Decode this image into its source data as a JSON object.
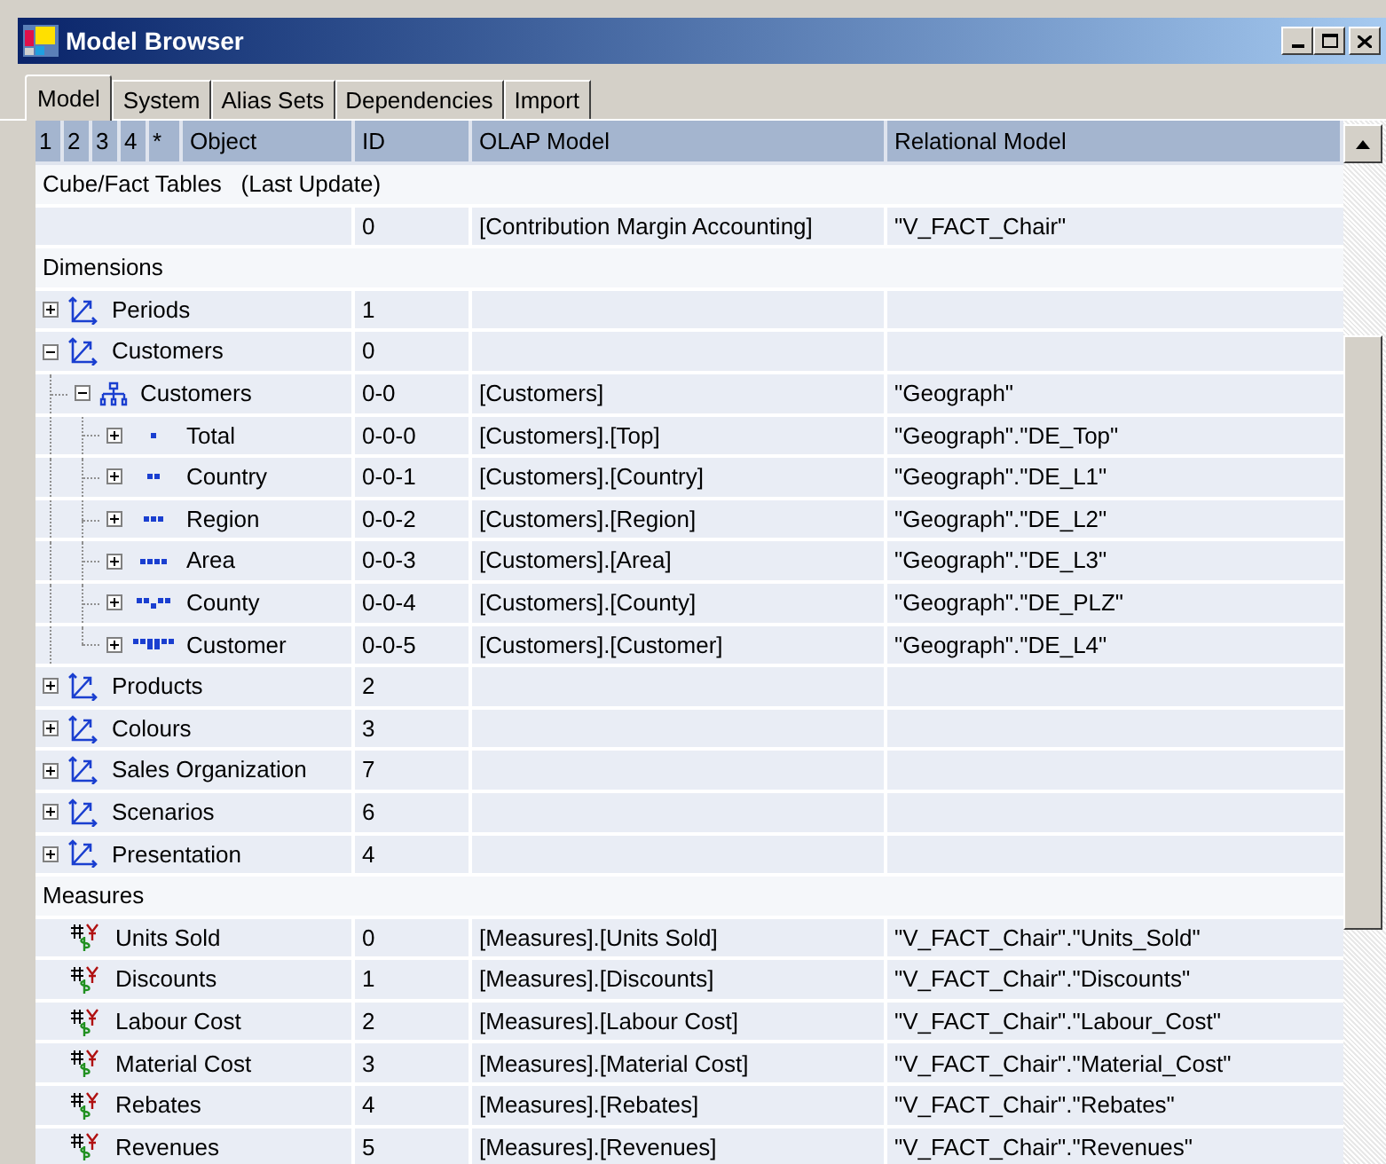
{
  "window": {
    "title": "Model Browser"
  },
  "tabs": [
    {
      "label": "Model",
      "selected": true
    },
    {
      "label": "System",
      "selected": false
    },
    {
      "label": "Alias Sets",
      "selected": false
    },
    {
      "label": "Dependencies",
      "selected": false
    },
    {
      "label": "Import",
      "selected": false
    }
  ],
  "table": {
    "level_buttons": [
      "1",
      "2",
      "3",
      "4",
      "*"
    ],
    "columns": [
      "Object",
      "ID",
      "OLAP Model",
      "Relational Model"
    ],
    "sections": [
      {
        "title": "Cube/Fact Tables   (Last Update)",
        "rows": [
          {
            "kind": "fact",
            "id": "0",
            "olap": "[Contribution Margin Accounting]",
            "relational": "\"V_FACT_Chair\""
          }
        ]
      },
      {
        "title": "Dimensions",
        "rows": [
          {
            "kind": "dimension",
            "object": "Periods",
            "id": "1",
            "expanded": false
          },
          {
            "kind": "dimension",
            "object": "Customers",
            "id": "0",
            "expanded": true,
            "children": [
              {
                "kind": "hierarchy",
                "object": "Customers",
                "id": "0-0",
                "olap": "[Customers]",
                "relational": "\"Geograph\"",
                "expanded": true,
                "children": [
                  {
                    "kind": "level",
                    "object": "Total",
                    "id": "0-0-0",
                    "olap": "[Customers].[Top]",
                    "relational": "\"Geograph\".\"DE_Top\"",
                    "expanded": false
                  },
                  {
                    "kind": "level",
                    "object": "Country",
                    "id": "0-0-1",
                    "olap": "[Customers].[Country]",
                    "relational": "\"Geograph\".\"DE_L1\"",
                    "expanded": false
                  },
                  {
                    "kind": "level",
                    "object": "Region",
                    "id": "0-0-2",
                    "olap": "[Customers].[Region]",
                    "relational": "\"Geograph\".\"DE_L2\"",
                    "expanded": false
                  },
                  {
                    "kind": "level",
                    "object": "Area",
                    "id": "0-0-3",
                    "olap": "[Customers].[Area]",
                    "relational": "\"Geograph\".\"DE_L3\"",
                    "expanded": false
                  },
                  {
                    "kind": "level",
                    "object": "County",
                    "id": "0-0-4",
                    "olap": "[Customers].[County]",
                    "relational": "\"Geograph\".\"DE_PLZ\"",
                    "expanded": false
                  },
                  {
                    "kind": "level",
                    "object": "Customer",
                    "id": "0-0-5",
                    "olap": "[Customers].[Customer]",
                    "relational": "\"Geograph\".\"DE_L4\"",
                    "expanded": false
                  }
                ]
              }
            ]
          },
          {
            "kind": "dimension",
            "object": "Products",
            "id": "2",
            "expanded": false
          },
          {
            "kind": "dimension",
            "object": "Colours",
            "id": "3",
            "expanded": false
          },
          {
            "kind": "dimension",
            "object": "Sales Organization",
            "id": "7",
            "expanded": false
          },
          {
            "kind": "dimension",
            "object": "Scenarios",
            "id": "6",
            "expanded": false
          },
          {
            "kind": "dimension",
            "object": "Presentation",
            "id": "4",
            "expanded": false
          }
        ]
      },
      {
        "title": "Measures",
        "rows": [
          {
            "kind": "measure",
            "object": "Units Sold",
            "id": "0",
            "olap": "[Measures].[Units Sold]",
            "relational": "\"V_FACT_Chair\".\"Units_Sold\""
          },
          {
            "kind": "measure",
            "object": "Discounts",
            "id": "1",
            "olap": "[Measures].[Discounts]",
            "relational": "\"V_FACT_Chair\".\"Discounts\""
          },
          {
            "kind": "measure",
            "object": "Labour Cost",
            "id": "2",
            "olap": "[Measures].[Labour Cost]",
            "relational": "\"V_FACT_Chair\".\"Labour_Cost\""
          },
          {
            "kind": "measure",
            "object": "Material Cost",
            "id": "3",
            "olap": "[Measures].[Material Cost]",
            "relational": "\"V_FACT_Chair\".\"Material_Cost\""
          },
          {
            "kind": "measure",
            "object": "Rebates",
            "id": "4",
            "olap": "[Measures].[Rebates]",
            "relational": "\"V_FACT_Chair\".\"Rebates\""
          },
          {
            "kind": "measure",
            "object": "Revenues",
            "id": "5",
            "olap": "[Measures].[Revenues]",
            "relational": "\"V_FACT_Chair\".\"Revenues\""
          }
        ]
      }
    ]
  }
}
